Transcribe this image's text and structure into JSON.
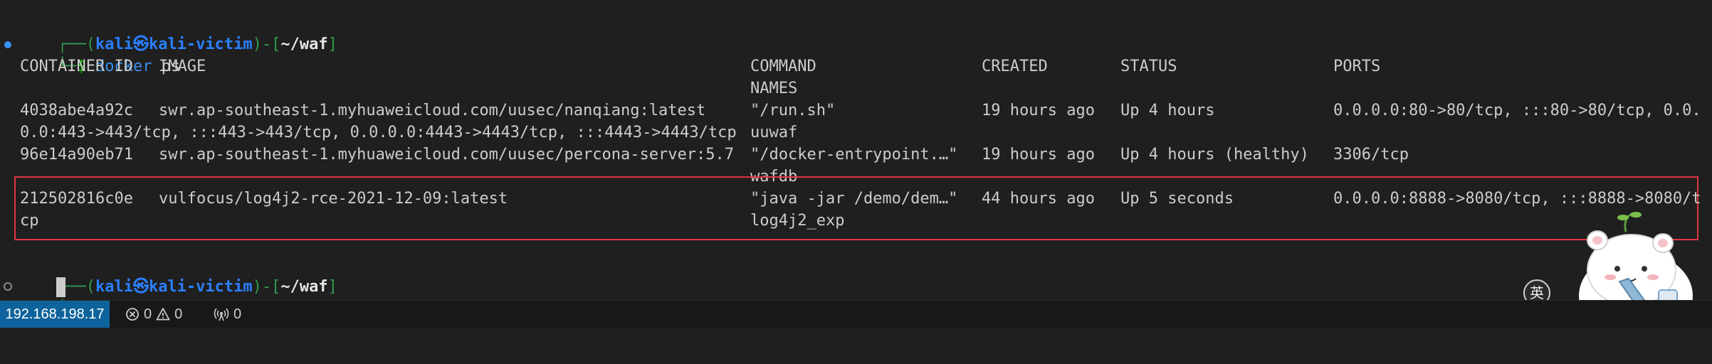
{
  "terminal": {
    "prompt1": {
      "frame_open": "┌──(",
      "user": "kali㉿kali-victim",
      "frame_mid": ")-[",
      "path": "~/waf",
      "frame_close": "]"
    },
    "cmd_line": {
      "frame": "└─",
      "dollar": "$ ",
      "command": "docker",
      "args": " ps"
    },
    "headers": {
      "container_id": "CONTAINER ID",
      "image": "IMAGE",
      "command": "COMMAND",
      "created": "CREATED",
      "status": "STATUS",
      "ports": "PORTS",
      "names": "NAMES"
    },
    "containers": [
      {
        "id": "4038abe4a92c",
        "image": "swr.ap-southeast-1.myhuaweicloud.com/uusec/nanqiang:latest",
        "command": "\"/run.sh\"",
        "created": "19 hours ago",
        "status": "Up 4 hours",
        "ports": "0.0.0.0:80->80/tcp, :::80->80/tcp, 0.0.",
        "ports_wrap": "0.0:443->443/tcp, :::443->443/tcp, 0.0.0.0:4443->4443/tcp, :::4443->4443/tcp",
        "name": "uuwaf"
      },
      {
        "id": "96e14a90eb71",
        "image": "swr.ap-southeast-1.myhuaweicloud.com/uusec/percona-server:5.7",
        "command": "\"/docker-entrypoint.…\"",
        "created": "19 hours ago",
        "status": "Up 4 hours (healthy)",
        "ports": "3306/tcp",
        "name": "wafdb"
      },
      {
        "id": "212502816c0e",
        "image": "vulfocus/log4j2-rce-2021-12-09:latest",
        "command": "\"java -jar /demo/dem…\"",
        "created": "44 hours ago",
        "status": "Up 5 seconds",
        "ports": "0.0.0.0:8888->8080/tcp, :::8888->8080/t",
        "ports_wrap": "cp",
        "name": "log4j2_exp"
      }
    ],
    "prompt2": {
      "frame_open": "┌──(",
      "user": "kali㉿kali-victim",
      "frame_mid": ")-[",
      "path": "~/waf",
      "frame_close": "]"
    },
    "prompt2_cmd": {
      "frame": "└─",
      "dollar": "$ "
    }
  },
  "statusbar": {
    "remote": "192.168.198.17",
    "errors": "0",
    "warnings": "0",
    "ports": "0"
  },
  "ime_indicator": "英",
  "colors": {
    "highlight_box": "#e0353f",
    "statusbar_remote_bg": "#0e639c",
    "user": "#2a7fff",
    "frame": "#2f9c4e"
  }
}
